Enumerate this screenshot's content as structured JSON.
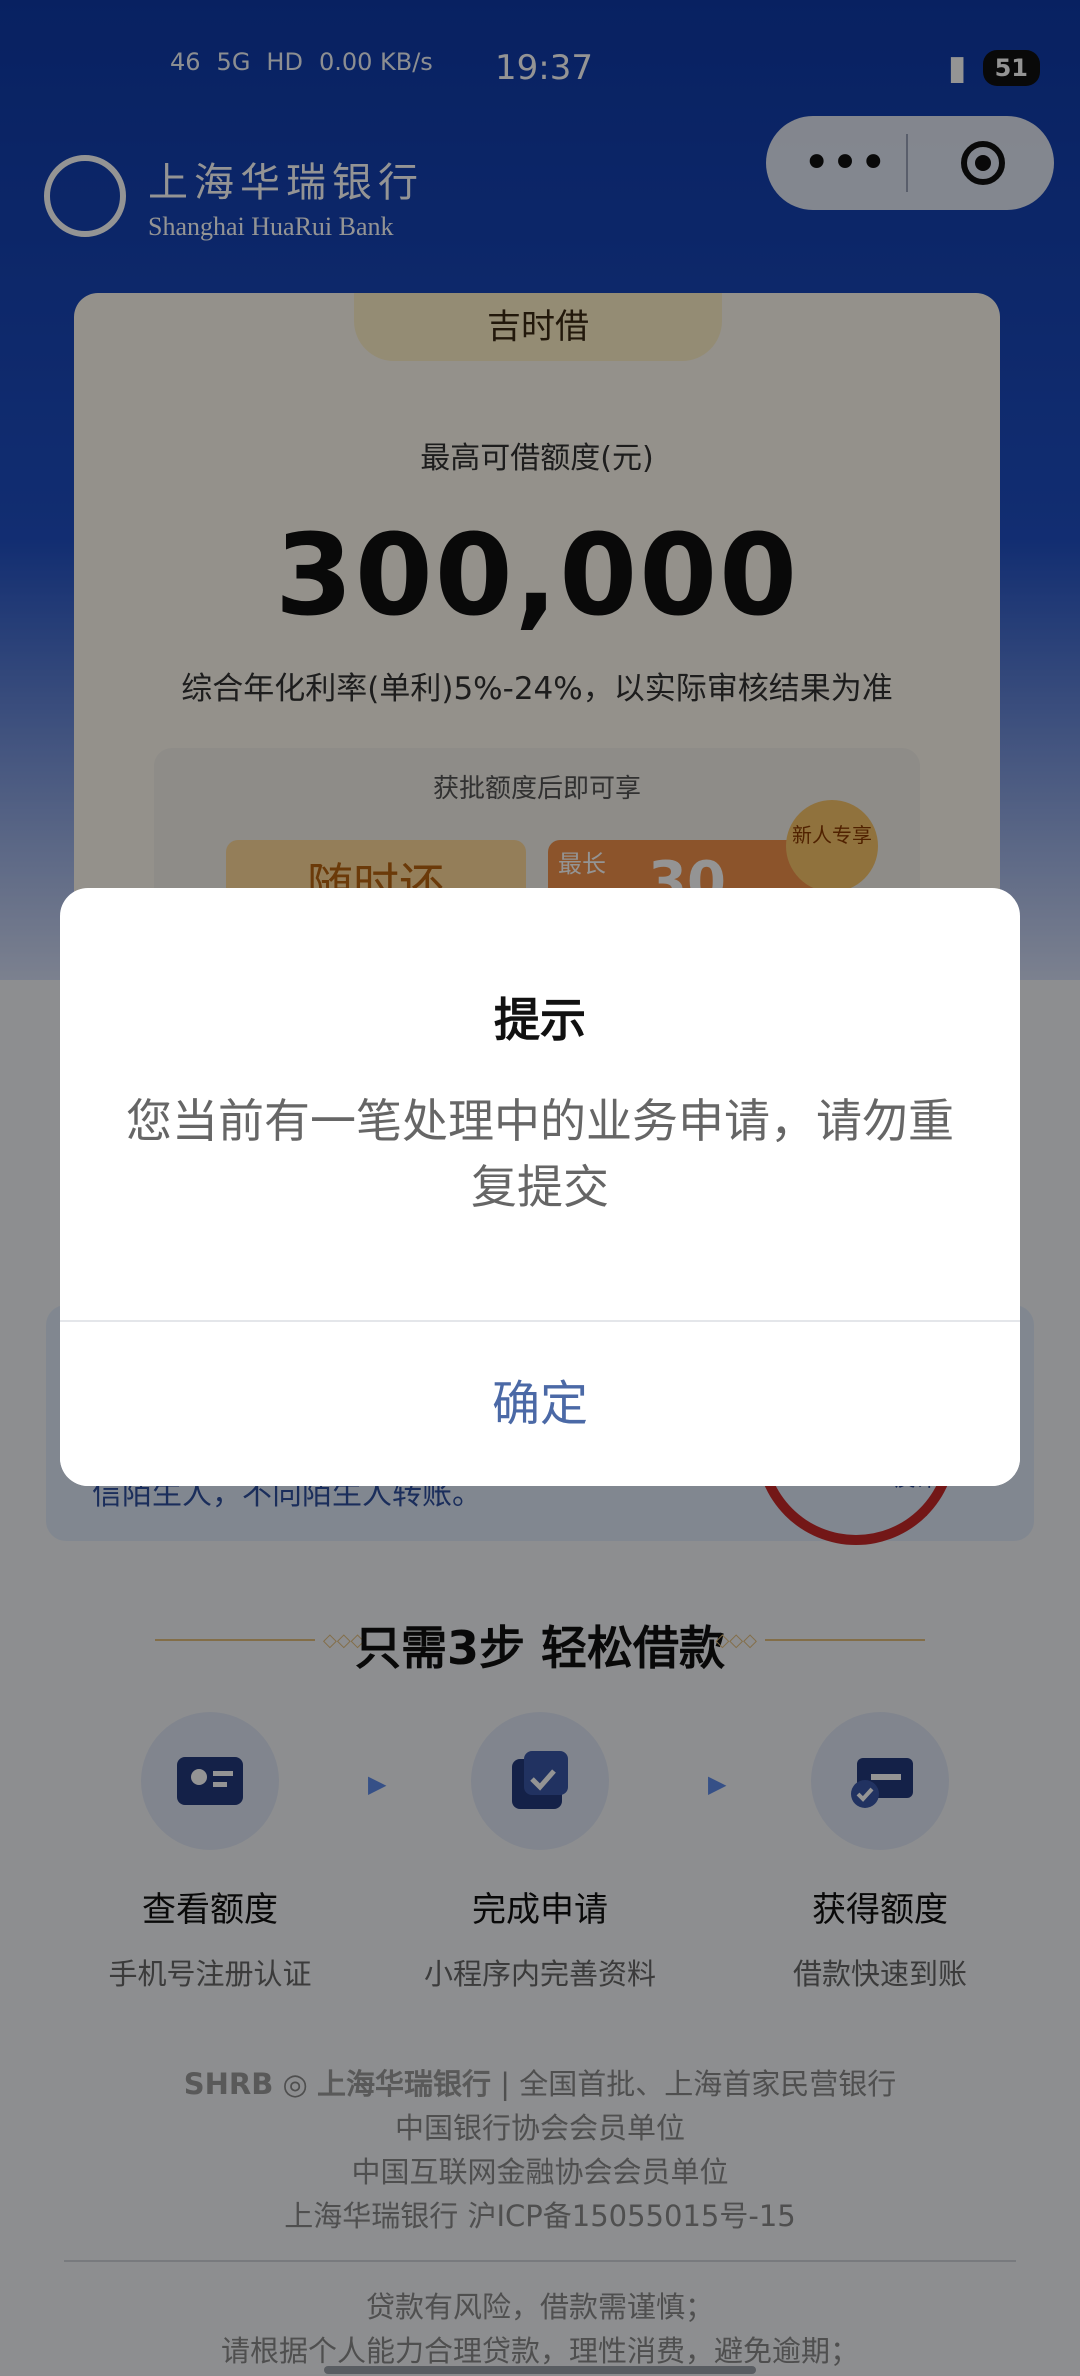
{
  "status_bar": {
    "left_signals": [
      "46",
      "5G",
      "HD",
      "0.00 KB/s"
    ],
    "time": "19:37",
    "battery": "51"
  },
  "header": {
    "logo_cn": "上海华瑞银行",
    "logo_en": "Shanghai HuaRui Bank"
  },
  "capsule": {
    "more_icon": "more-dots-icon",
    "close_icon": "record-circle-icon"
  },
  "loan_card": {
    "tag": "吉时借",
    "subtitle": "最高可借额度(元)",
    "amount": "300,000",
    "rate_note": "综合年化利率(单利)5%-24%，以实际审核结果为准",
    "perk_title": "获批额度后即可享",
    "perk1": "随时还",
    "perk2_label": "最长",
    "perk2_value": "30",
    "badge": "新人专享"
  },
  "anti_fraud": {
    "text": "信陌生人，不向陌生人转账。",
    "stamp_label": "反诈"
  },
  "steps": {
    "title": "只需3步 轻松借款",
    "items": [
      {
        "title": "查看额度",
        "desc": "手机号注册认证",
        "icon": "id-card-icon"
      },
      {
        "title": "完成申请",
        "desc": "小程序内完善资料",
        "icon": "checklist-icon"
      },
      {
        "title": "获得额度",
        "desc": "借款快速到账",
        "icon": "card-check-icon"
      }
    ]
  },
  "footer": {
    "brand_line_prefix": "SHRB",
    "brand_line_bank": "上海华瑞银行",
    "brand_line_suffix": "全国首批、上海首家民营银行",
    "line2": "中国银行协会会员单位",
    "line3": "中国互联网金融协会会员单位",
    "line4": "上海华瑞银行  沪ICP备15055015号-15",
    "risk1": "贷款有风险，借款需谨慎；",
    "risk2": "请根据个人能力合理贷款，理性消费，避免逾期；"
  },
  "dialog": {
    "title": "提示",
    "message": "您当前有一笔处理中的业务申请，请勿重复提交",
    "confirm": "确定"
  }
}
